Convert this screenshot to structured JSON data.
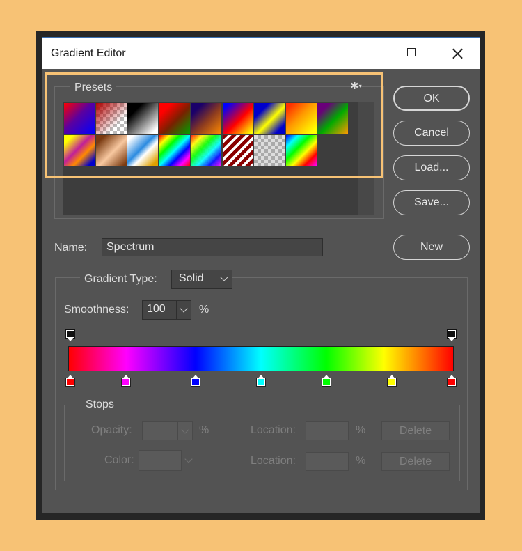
{
  "window": {
    "title": "Gradient Editor"
  },
  "presets": {
    "label": "Presets",
    "settings_icon": "gear-icon",
    "swatches": [
      {
        "css": "linear-gradient(135deg,#ff0000 0%,#5a00a0 45%,#0000ff 100%)"
      },
      {
        "css": "linear-gradient(135deg,#b00000 0%,rgba(180,0,0,0) 70%),repeating-conic-gradient(#bbbbbb 0% 25%,#ffffff 0% 50%) 0 0/10px 10px"
      },
      {
        "css": "linear-gradient(135deg,#000000 25%,#ffffff 90%)"
      },
      {
        "css": "linear-gradient(135deg,#ff0000 20%,#7a2000 55%,#00a000 100%)"
      },
      {
        "css": "linear-gradient(135deg,#1a006a 20%,#8a3a20 55%,#ff8a00 100%)"
      },
      {
        "css": "linear-gradient(135deg,#0000ff 10%,#ff0000 55%,#ffff00 95%)"
      },
      {
        "css": "linear-gradient(135deg,#0000cc 25%,#ffff00 55%,#0000cc 85%)"
      },
      {
        "css": "linear-gradient(135deg,#ff3000 10%,#ff9900 45%,#ffff00 90%)"
      },
      {
        "css": "linear-gradient(135deg,#6a007a 20%,#00aa00 55%,#ff9900 100%)"
      },
      {
        "css": "linear-gradient(135deg,#ffff00 15%,#c0209a 45%,#ff8a00 65%,#0000cc 90%)"
      },
      {
        "css": "linear-gradient(135deg,#7a3a10 15%,#f8c8a0 55%,#7a3a10 95%)"
      },
      {
        "css": "linear-gradient(135deg,#ffffff 10%,#2a8ae0 45%,#ffffff 60%,#e0a000 90%)"
      },
      {
        "css": "linear-gradient(135deg,#ff0000,#ffff00,#00ff00,#00ffff,#0000ff,#ff00ff,#ff0000)"
      },
      {
        "css": "linear-gradient(135deg,rgba(255,0,0,0.9),rgba(255,255,0,0.9),rgba(0,255,0,0.9),rgba(0,255,255,0.9),rgba(0,0,255,0.9),rgba(255,0,255,0.9)),repeating-conic-gradient(#cccccc 0% 25%,#ffffff 0% 50%) 0 0/10px 10px"
      },
      {
        "css": "repeating-linear-gradient(135deg,#8a0000 0 5px,#ffffff 5px 9px)"
      },
      {
        "css": "repeating-conic-gradient(#aaaaaa 0% 25%,#dddddd 0% 50%) 0 0/10px 10px"
      },
      {
        "css": "linear-gradient(135deg,#0000ff,#00ffff,#00ff00,#ffff00,#ff0000,#ff00ff)"
      }
    ]
  },
  "buttons": {
    "ok": "OK",
    "cancel": "Cancel",
    "load": "Load...",
    "save": "Save...",
    "new": "New"
  },
  "name_field": {
    "label": "Name:",
    "value": "Spectrum"
  },
  "gradient_type": {
    "label": "Gradient Type:",
    "value": "Solid"
  },
  "smoothness": {
    "label": "Smoothness:",
    "value": "100",
    "unit": "%"
  },
  "gradient_bar": {
    "css": "linear-gradient(to right,#ff0000 0%,#ff00ff 15%,#0000ff 33%,#00ffff 50%,#00ff00 67%,#ffff00 82%,#ff0000 100%)",
    "opacity_stops": [
      0,
      100
    ],
    "color_stops": [
      {
        "location": 0,
        "color": "#ff0000"
      },
      {
        "location": 15,
        "color": "#ff00ff"
      },
      {
        "location": 33,
        "color": "#0000ff"
      },
      {
        "location": 50,
        "color": "#00ffff"
      },
      {
        "location": 67,
        "color": "#00ff00"
      },
      {
        "location": 84,
        "color": "#ffff00"
      },
      {
        "location": 100,
        "color": "#ff0000"
      }
    ]
  },
  "stops": {
    "label": "Stops",
    "opacity_label": "Opacity:",
    "opacity_unit": "%",
    "opacity_location_label": "Location:",
    "opacity_location_unit": "%",
    "opacity_delete": "Delete",
    "color_label": "Color:",
    "color_location_label": "Location:",
    "color_location_unit": "%",
    "color_delete": "Delete"
  },
  "colors": {
    "highlight": "#F7C275",
    "dialog_bg": "#535353",
    "accent_border": "#3a6fb0"
  }
}
